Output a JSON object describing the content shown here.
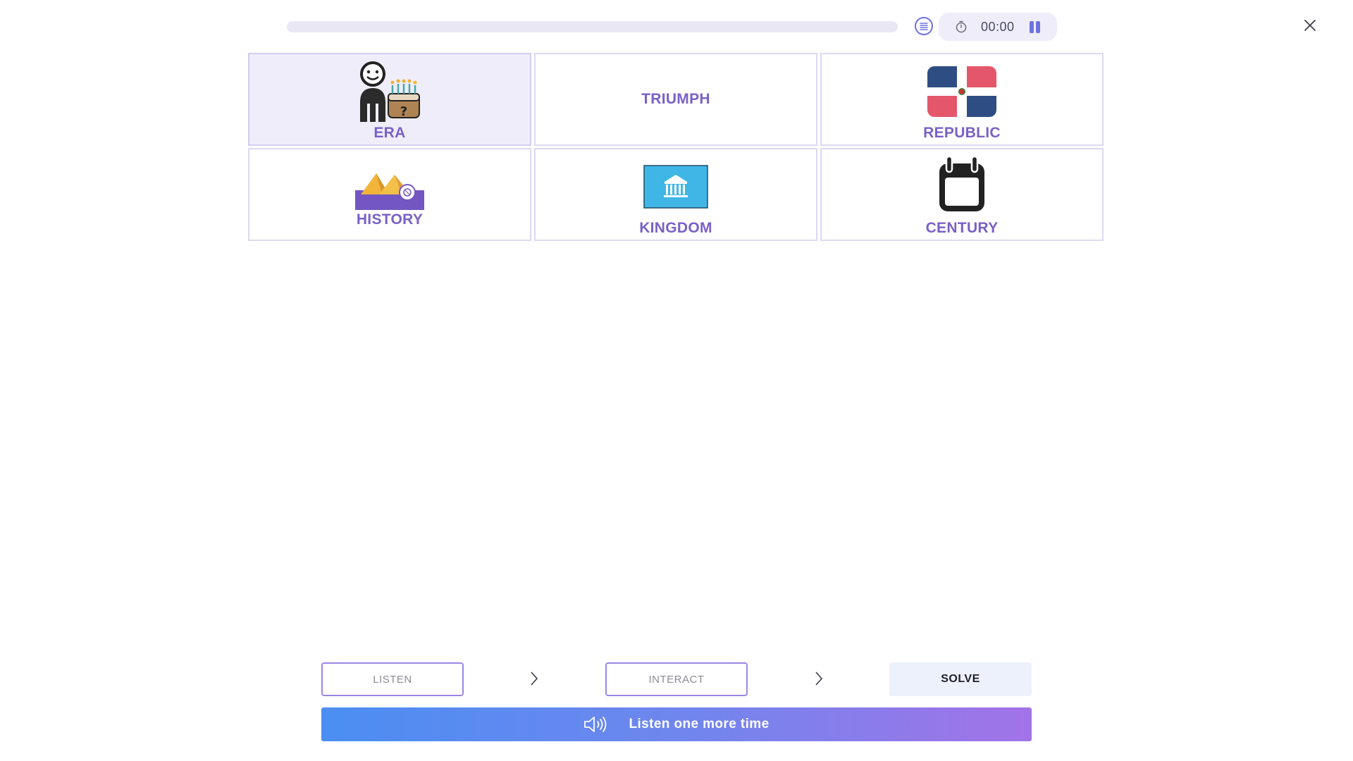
{
  "header": {
    "progress": 0.0,
    "timer": "00:00",
    "icons": {
      "transcript": "list-icon",
      "timer": "stopwatch-icon",
      "pause": "pause-icon",
      "close": "close-icon"
    }
  },
  "cards": [
    {
      "label": "ERA",
      "icon": "person-birthday-cake-icon",
      "selected": true
    },
    {
      "label": "TRIUMPH",
      "icon": "",
      "selected": false
    },
    {
      "label": "REPUBLIC",
      "icon": "dominican-flag-icon",
      "selected": false
    },
    {
      "label": "HISTORY",
      "icon": "pyramids-icon",
      "selected": false
    },
    {
      "label": "KINGDOM",
      "icon": "unesco-flag-icon",
      "selected": false
    },
    {
      "label": "CENTURY",
      "icon": "calendar-icon",
      "selected": false
    }
  ],
  "steps": [
    {
      "label": "LISTEN"
    },
    {
      "label": "INTERACT"
    },
    {
      "label": "SOLVE"
    }
  ],
  "listen_again": {
    "label": "Listen one more time",
    "icon": "speaker-icon"
  },
  "colors": {
    "accent": "#6d72e0",
    "label_purple": "#7a60c6",
    "gradient_start": "#4b8ef2",
    "gradient_end": "#a273e8"
  }
}
